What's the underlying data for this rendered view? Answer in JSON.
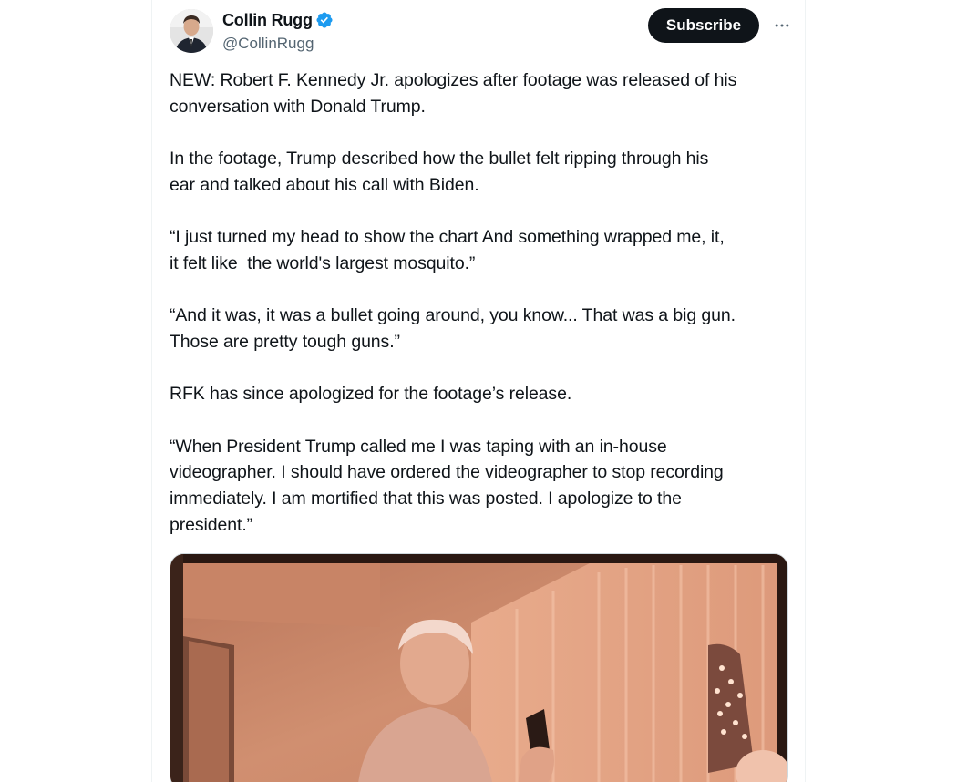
{
  "author": {
    "display_name": "Collin Rugg",
    "handle": "@CollinRugg",
    "verified_icon": "verified-badge-icon",
    "avatar_icon": "avatar"
  },
  "actions": {
    "subscribe_label": "Subscribe",
    "more_icon": "more-options-icon"
  },
  "tweet": {
    "paragraphs": [
      "NEW: Robert F. Kennedy Jr. apologizes after footage was released of his\nconversation with Donald Trump.",
      "In the footage, Trump described how the bullet felt ripping through his\near and talked about his call with Biden.",
      "“I just turned my head to show the chart And something wrapped me, it,\nit felt like  the world's largest mosquito.”",
      "“And it was, it was a bullet going around, you know... That was a big gun.\nThose are pretty tough guns.”",
      "RFK has since apologized for the footage’s release.",
      "“When President Trump called me I was taping with an in-house\nvideographer. I should have ordered the videographer to stop recording\nimmediately. I am mortified that this was posted. I apologize to the\npresident.”"
    ]
  },
  "colors": {
    "text_primary": "#0f1419",
    "text_secondary": "#536471",
    "verified_blue": "#1d9bf0",
    "button_dark": "#0f1419",
    "media_tone": "#c8876a"
  }
}
